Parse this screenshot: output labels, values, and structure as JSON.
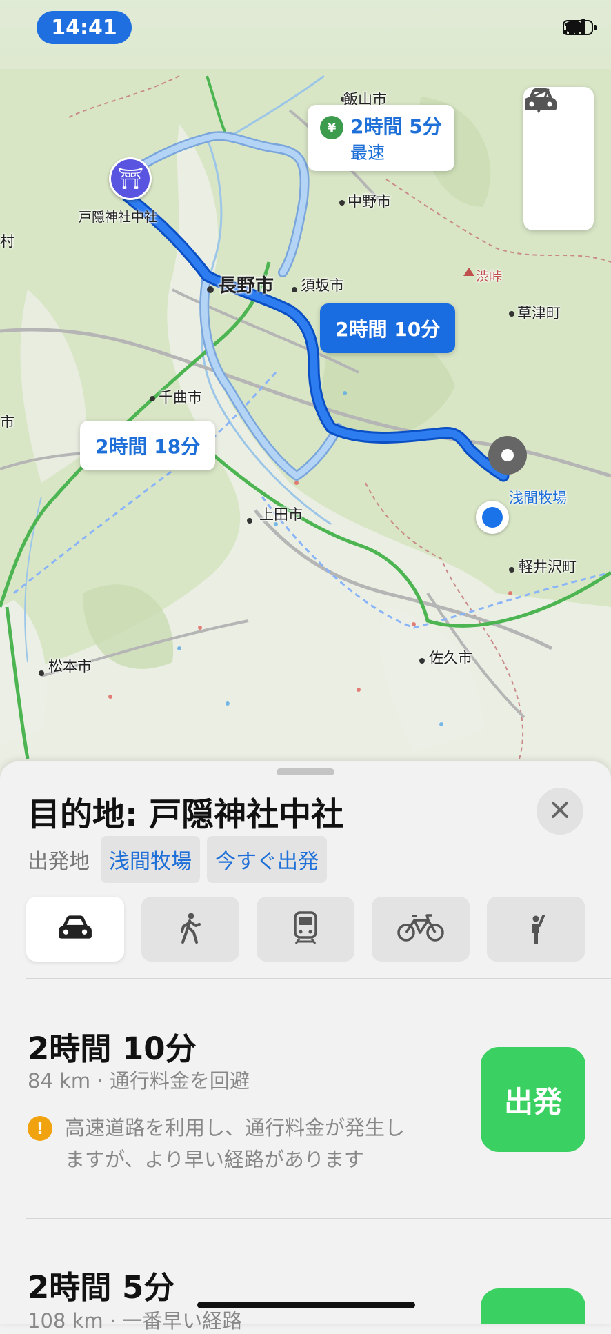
{
  "status_bar": {
    "time": "14:41",
    "signal_icon": "cellular-signal-icon",
    "wifi_icon": "wifi-icon",
    "battery_icon": "battery-icon"
  },
  "map": {
    "cities": {
      "iiyama": "飯山市",
      "nakano": "中野市",
      "nagano": "長野市",
      "suzaka": "須坂市",
      "chikuma": "千曲市",
      "ueda": "上田市",
      "matsumoto": "松本市",
      "saku": "佐久市",
      "karuizawa": "軽井沢町",
      "kusatsu": "草津町",
      "shibu_pass": "渋峠",
      "togakushi": "戸隠神社中社",
      "asama": "浅間牧場",
      "edge_mura": "村",
      "edge_shi": "市"
    },
    "routes": {
      "fastest_time": "2時間 5分",
      "fastest_label": "最速",
      "selected_time": "2時間 10分",
      "alt_time": "2時間 18分"
    },
    "controls": {
      "drive_mode_icon": "car-icon",
      "locate_icon": "location-arrow-icon"
    },
    "pins": {
      "destination_icon": "shrine-icon",
      "origin_icon": "pin-icon"
    }
  },
  "sheet": {
    "title": "目的地: 戸隠神社中社",
    "origin_label": "出発地",
    "origin_chip": "浅間牧場",
    "depart_chip": "今すぐ出発",
    "modes": [
      "car-icon",
      "walk-icon",
      "train-icon",
      "bicycle-icon",
      "ride-hail-icon"
    ],
    "route1": {
      "time": "2時間 10分",
      "meta": "84 km · 通行料金を回避",
      "warning_line1": "高速道路を利用し、通行料金が発生し",
      "warning_line2": "ますが、より早い経路があります",
      "go_label": "出発"
    },
    "route2": {
      "time": "2時間 5分",
      "meta": "108 km · 一番早い経路"
    }
  },
  "colors": {
    "accent": "#1a6de0",
    "go": "#3bd162",
    "warning": "#f1a30f"
  }
}
